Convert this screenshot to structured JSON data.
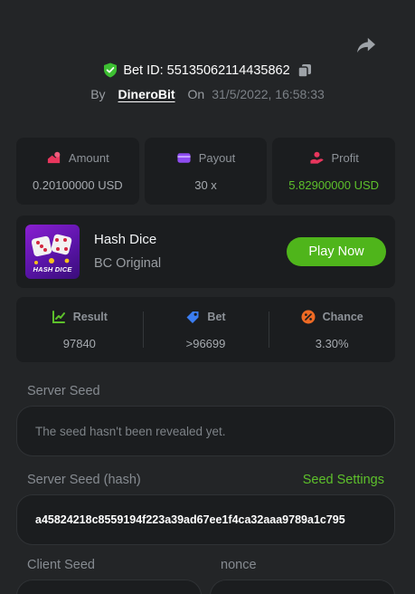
{
  "bet": {
    "id_text": "Bet ID: 55135062114435862",
    "by_label": "By",
    "username": "DineroBit",
    "on_label": "On",
    "datetime": "31/5/2022, 16:58:33"
  },
  "stats": [
    {
      "label": "Amount",
      "value": "0.20100000 USD",
      "icon": "coins-icon",
      "color": "#e8365d"
    },
    {
      "label": "Payout",
      "value": "30 x",
      "icon": "wallet-icon",
      "color": "#8e4cf0"
    },
    {
      "label": "Profit",
      "value": "5.82900000 USD",
      "icon": "profit-icon",
      "color": "#e8365d"
    }
  ],
  "game": {
    "name": "Hash Dice",
    "subtitle": "BC Original",
    "thumb_text": "HASH DICE",
    "play_label": "Play Now"
  },
  "results": [
    {
      "label": "Result",
      "value": "97840",
      "icon": "result-icon",
      "color": "#5dc02b"
    },
    {
      "label": "Bet",
      "value": ">96699",
      "icon": "tag-icon",
      "color": "#3b7df0"
    },
    {
      "label": "Chance",
      "value": "3.30%",
      "icon": "percent-icon",
      "color": "#ee6a24"
    }
  ],
  "seeds": {
    "server_seed_label": "Server Seed",
    "server_seed_value": "The seed hasn't been revealed yet.",
    "server_hash_label": "Server Seed (hash)",
    "seed_settings_label": "Seed Settings",
    "server_hash_value": "a45824218c8559194f223a39ad67ee1f4ca32aaa9789a1c795",
    "client_seed_label": "Client Seed",
    "nonce_label": "nonce"
  },
  "colors": {
    "background": "#232527",
    "card": "#1b1d1f",
    "accent_green": "#5dc02b",
    "button_green": "#4fb51b"
  }
}
